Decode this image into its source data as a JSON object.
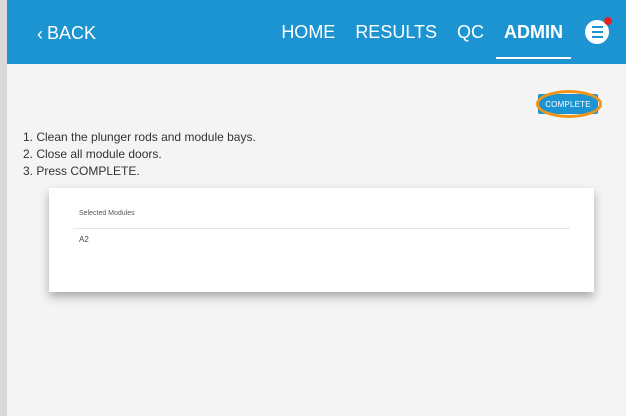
{
  "topbar": {
    "back_label": "BACK",
    "back_chevron": "‹",
    "nav": [
      "HOME",
      "RESULTS",
      "QC",
      "ADMIN"
    ],
    "active_nav": "ADMIN",
    "menu_icon": "hamburger-menu-icon",
    "notification": true
  },
  "actions": {
    "complete_label": "COMPLETE"
  },
  "instructions": [
    "1. Clean the plunger rods and module bays.",
    "2. Close all module doors.",
    "3. Press COMPLETE."
  ],
  "modules_card": {
    "header": "Selected Modules",
    "items": [
      "A2"
    ]
  },
  "colors": {
    "accent": "#1d94d2",
    "highlight_ring": "#f29418",
    "notification": "#e02424",
    "background": "#f4f4f4"
  }
}
